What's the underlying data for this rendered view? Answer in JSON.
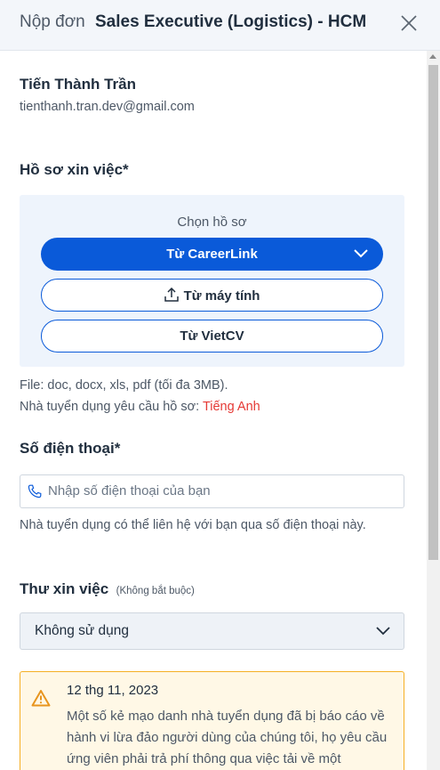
{
  "header": {
    "prefix": "Nộp đơn",
    "job_title": "Sales Executive (Logistics) - HCM"
  },
  "applicant": {
    "name": "Tiến Thành Trần",
    "email": "tienthanh.tran.dev@gmail.com"
  },
  "cv_section": {
    "title": "Hồ sơ xin việc*",
    "choose_label": "Chọn hồ sơ",
    "from_careerlink": "Từ CareerLink",
    "from_computer": "Từ máy tính",
    "from_vietcv": "Từ VietCV",
    "file_hint": "File: doc, docx, xls, pdf (tối đa 3MB).",
    "lang_hint_prefix": "Nhà tuyển dụng yêu cầu hồ sơ:",
    "lang_required": "Tiếng Anh"
  },
  "phone_section": {
    "title": "Số điện thoại*",
    "placeholder": "Nhập số điện thoại của bạn",
    "value": "",
    "hint": "Nhà tuyển dụng có thể liên hệ với bạn qua số điện thoại này."
  },
  "cover_letter": {
    "title": "Thư xin việc",
    "optional": "(Không bắt buộc)",
    "selected": "Không sử dụng"
  },
  "warning": {
    "date": "12 thg 11, 2023",
    "text": "Một số kẻ mạo danh nhà tuyển dụng đã bị báo cáo về hành vi lừa đảo người dùng của chúng tôi, họ yêu cầu ứng viên phải trả phí thông qua việc tải về một"
  },
  "colors": {
    "primary": "#0a5ad9",
    "required_lang": "#e53935",
    "warning_border": "#f5b025",
    "warning_bg": "#fff8e6",
    "cv_box_bg": "#eef4fc"
  },
  "icons": {
    "close": "close-icon",
    "chevron": "chevron-down-icon",
    "upload": "upload-icon",
    "phone": "phone-icon",
    "warning": "warning-icon"
  }
}
